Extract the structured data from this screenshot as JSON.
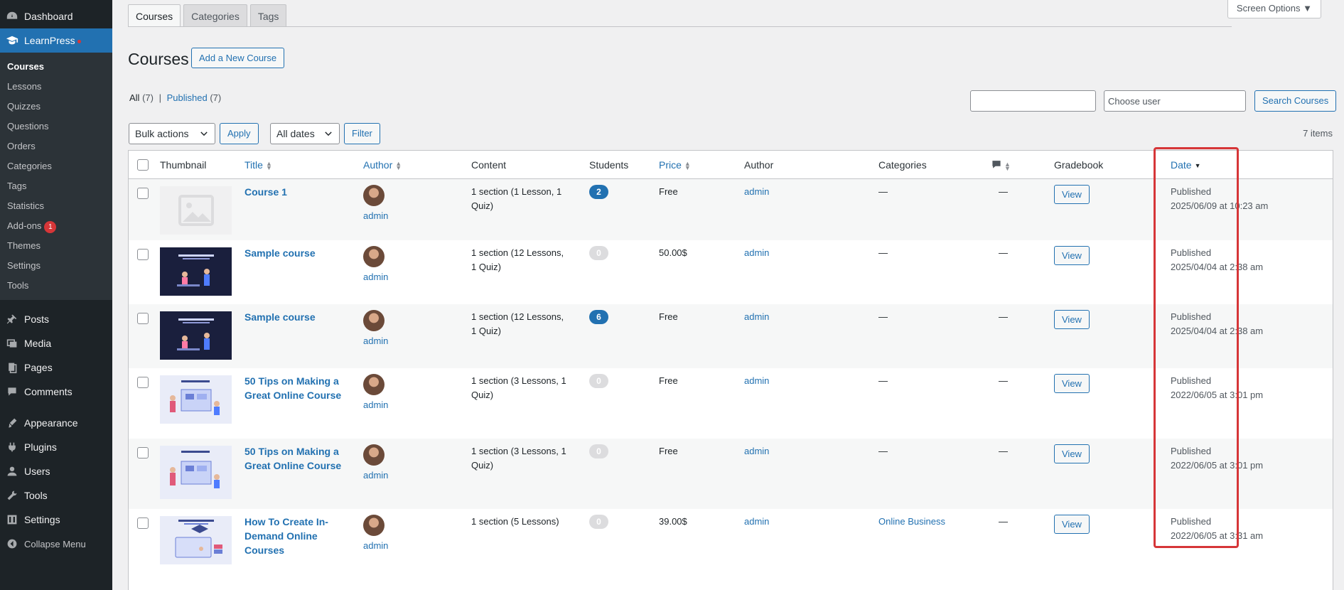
{
  "sidebar": {
    "items_top": [
      {
        "label": "Dashboard",
        "icon": "dashboard-icon"
      },
      {
        "label": "LearnPress",
        "icon": "graduation-cap-icon"
      }
    ],
    "submenu": [
      {
        "label": "Courses"
      },
      {
        "label": "Lessons"
      },
      {
        "label": "Quizzes"
      },
      {
        "label": "Questions"
      },
      {
        "label": "Orders"
      },
      {
        "label": "Categories"
      },
      {
        "label": "Tags"
      },
      {
        "label": "Statistics"
      },
      {
        "label": "Add-ons",
        "badge": "1"
      },
      {
        "label": "Themes"
      },
      {
        "label": "Settings"
      },
      {
        "label": "Tools"
      }
    ],
    "items_bottom": [
      {
        "label": "Posts",
        "icon": "pin-icon"
      },
      {
        "label": "Media",
        "icon": "media-icon"
      },
      {
        "label": "Pages",
        "icon": "pages-icon"
      },
      {
        "label": "Comments",
        "icon": "comments-icon"
      },
      {
        "label": "Appearance",
        "icon": "brush-icon"
      },
      {
        "label": "Plugins",
        "icon": "plugin-icon"
      },
      {
        "label": "Users",
        "icon": "users-icon"
      },
      {
        "label": "Tools",
        "icon": "wrench-icon"
      },
      {
        "label": "Settings",
        "icon": "settings-icon"
      },
      {
        "label": "Collapse Menu",
        "icon": "collapse-icon"
      }
    ]
  },
  "tabs": [
    "Courses",
    "Categories",
    "Tags"
  ],
  "screen_options": "Screen Options ▼",
  "page_title": "Courses",
  "add_new_label": "Add a New Course",
  "views": {
    "all": "All",
    "all_count": "(7)",
    "separator": "|",
    "published": "Published",
    "published_count": "(7)"
  },
  "search": {
    "user_placeholder": "Choose user",
    "button": "Search Courses"
  },
  "bulk": {
    "actions": "Bulk actions",
    "apply": "Apply",
    "dates": "All dates",
    "filter": "Filter"
  },
  "items_count": "7 items",
  "columns": {
    "thumbnail": "Thumbnail",
    "title": "Title",
    "author": "Author",
    "content": "Content",
    "students": "Students",
    "price": "Price",
    "author2": "Author",
    "categories": "Categories",
    "gradebook": "Gradebook",
    "date": "Date"
  },
  "rows": [
    {
      "title": "Course 1",
      "author": "admin",
      "content": "1 section (1 Lesson, 1 Quiz)",
      "students": "2",
      "price": "Free",
      "author2": "admin",
      "categories": "—",
      "comments": "—",
      "view": "View",
      "status": "Published",
      "date": "2025/06/09 at 10:23 am",
      "thumb": "placeholder"
    },
    {
      "title": "Sample course",
      "author": "admin",
      "content": "1 section (12 Lessons, 1 Quiz)",
      "students": "0",
      "price": "50.00$",
      "author2": "admin",
      "categories": "—",
      "comments": "—",
      "view": "View",
      "status": "Published",
      "date": "2025/04/04 at 2:38 am",
      "thumb": "dark"
    },
    {
      "title": "Sample course",
      "author": "admin",
      "content": "1 section (12 Lessons, 1 Quiz)",
      "students": "6",
      "price": "Free",
      "author2": "admin",
      "categories": "—",
      "comments": "—",
      "view": "View",
      "status": "Published",
      "date": "2025/04/04 at 2:38 am",
      "thumb": "dark"
    },
    {
      "title": "50 Tips on Making a Great Online Course",
      "author": "admin",
      "content": "1 section (3 Lessons, 1 Quiz)",
      "students": "0",
      "price": "Free",
      "author2": "admin",
      "categories": "—",
      "comments": "—",
      "view": "View",
      "status": "Published",
      "date": "2022/06/05 at 3:01 pm",
      "thumb": "light"
    },
    {
      "title": "50 Tips on Making a Great Online Course",
      "author": "admin",
      "content": "1 section (3 Lessons, 1 Quiz)",
      "students": "0",
      "price": "Free",
      "author2": "admin",
      "categories": "—",
      "comments": "—",
      "view": "View",
      "status": "Published",
      "date": "2022/06/05 at 3:01 pm",
      "thumb": "light"
    },
    {
      "title": "How To Create In-Demand Online Courses",
      "author": "admin",
      "content": "1 section (5 Lessons)",
      "students": "0",
      "price": "39.00$",
      "author2": "admin",
      "categories": "Online Business",
      "comments": "—",
      "view": "View",
      "status": "Published",
      "date": "2022/06/05 at 3:31 am",
      "thumb": "light2"
    }
  ]
}
